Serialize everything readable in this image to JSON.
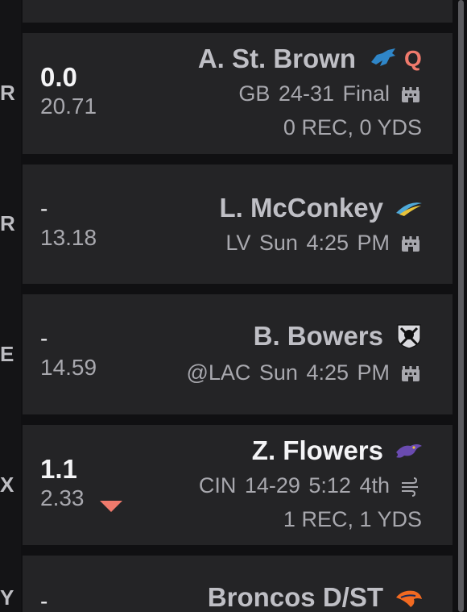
{
  "colors": {
    "background": "#101012",
    "card": "#242426",
    "accent_red": "#f07a6c",
    "text_primary": "#f4f4f6",
    "text_secondary": "#a8a8ae"
  },
  "rows": [
    {
      "pos": "R",
      "score": "0.0",
      "proj": "20.71",
      "name": "A. St. Brown",
      "team_icon": "lions-logo-icon",
      "status": "Q",
      "game": "GB  24-31  Final",
      "weather_icon": "stadium-icon",
      "stats": "0 REC, 0 YDS"
    },
    {
      "pos": "R",
      "score": "-",
      "proj": "13.18",
      "name": "L. McConkey",
      "team_icon": "chargers-logo-icon",
      "game": "LV  Sun  4:25 PM",
      "weather_icon": "stadium-icon"
    },
    {
      "pos": "E",
      "score": "-",
      "proj": "14.59",
      "name": "B. Bowers",
      "team_icon": "raiders-logo-icon",
      "game": "@LAC  Sun  4:25 PM",
      "weather_icon": "stadium-icon"
    },
    {
      "pos": "X",
      "score": "1.1",
      "proj": "2.33",
      "name": "Z. Flowers",
      "team_icon": "ravens-logo-icon",
      "game": "CIN  14-29  5:12  4th",
      "weather_icon": "wind-icon",
      "stats": "1 REC, 1 YDS",
      "trend_icon": "down-arrow-icon"
    },
    {
      "pos": "Y",
      "score": "-",
      "name": "Broncos D/ST",
      "team_icon": "broncos-logo-icon"
    }
  ]
}
